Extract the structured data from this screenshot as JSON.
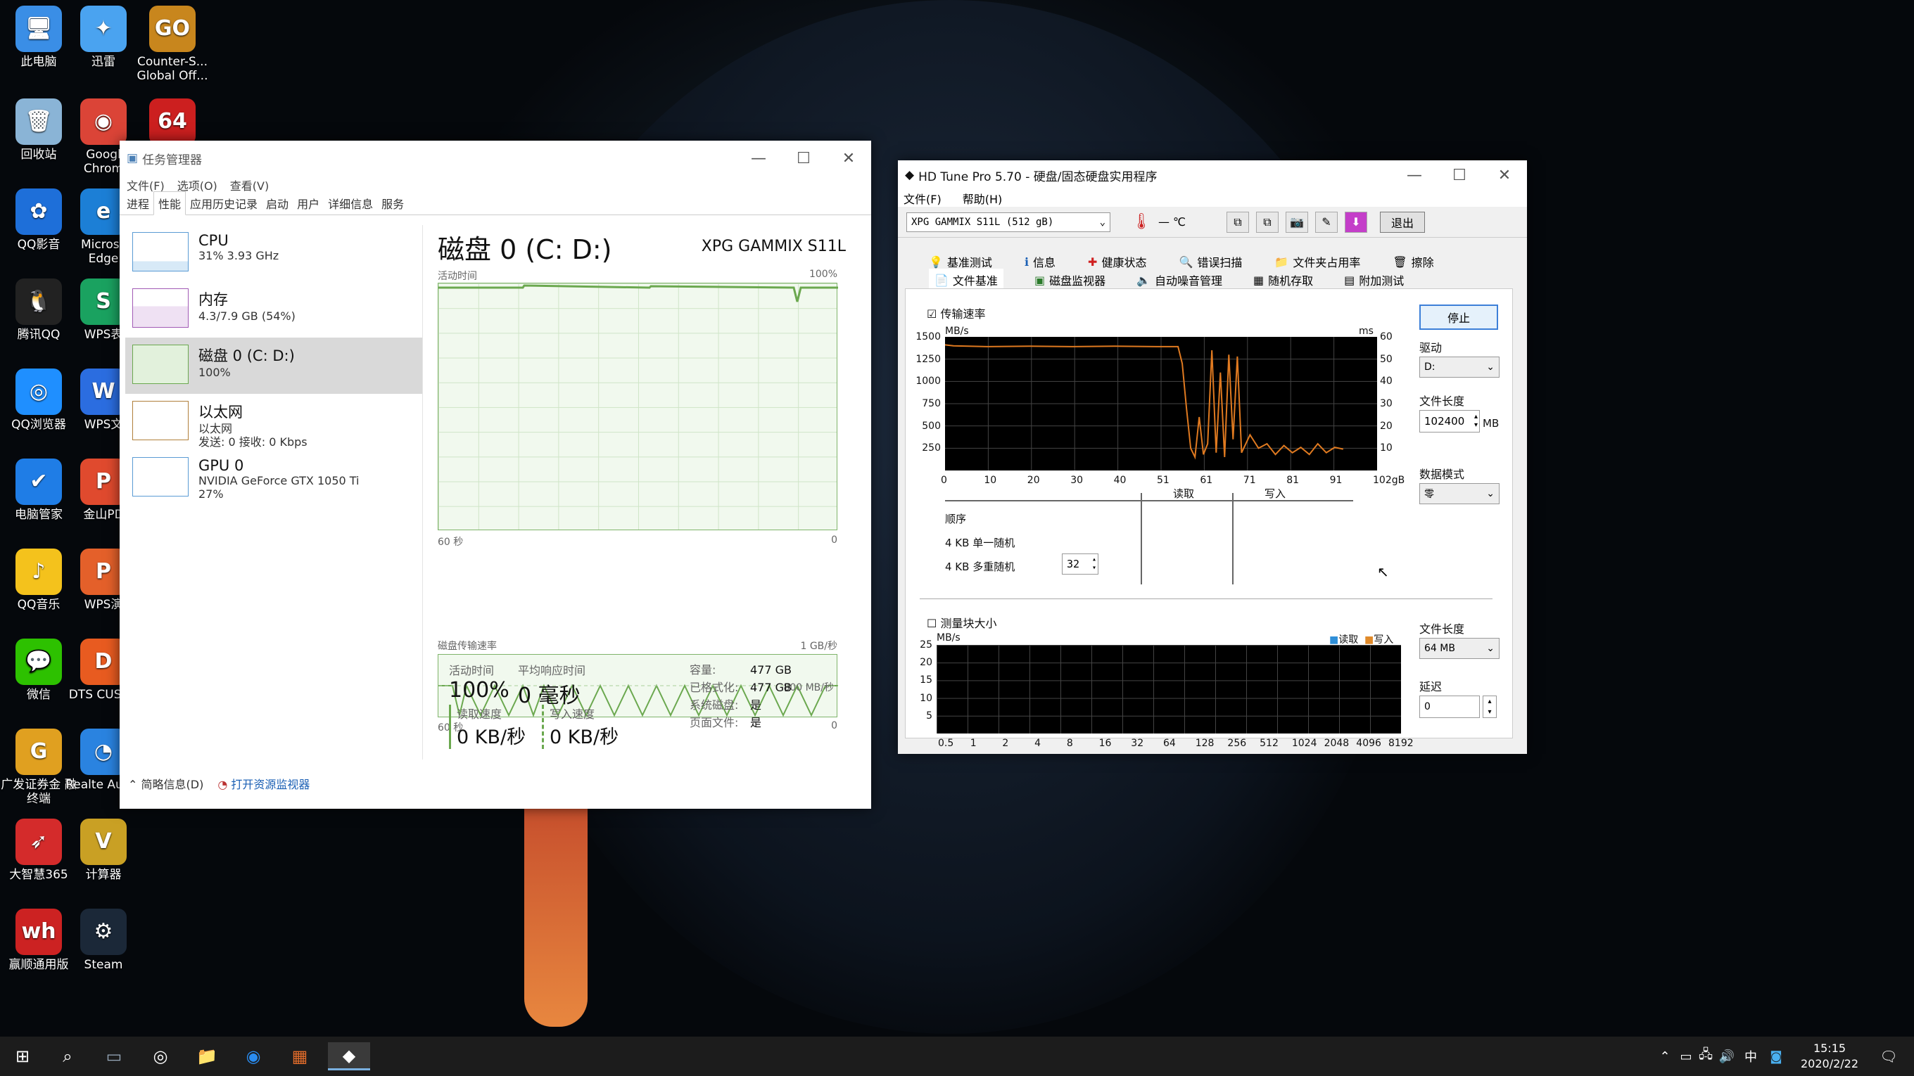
{
  "desktop_icons": [
    {
      "label": "此电脑",
      "color": "#3a8ee6",
      "glyph": "🖥",
      "x": 0,
      "y": 8
    },
    {
      "label": "迅雷",
      "color": "#4aa3f0",
      "glyph": "✦",
      "x": 92,
      "y": 8
    },
    {
      "label": "Counter-S... Global Off...",
      "color": "#c8861d",
      "glyph": "GO",
      "x": 190,
      "y": 8
    },
    {
      "label": "回收站",
      "color": "#8ab4d6",
      "glyph": "🗑",
      "x": 0,
      "y": 140
    },
    {
      "label": "Googl Chrom",
      "color": "#db4437",
      "glyph": "◉",
      "x": 92,
      "y": 140
    },
    {
      "label": "",
      "color": "#cc1f1f",
      "glyph": "64",
      "x": 190,
      "y": 140
    },
    {
      "label": "QQ影音",
      "color": "#1e6fd9",
      "glyph": "✿",
      "x": 0,
      "y": 268
    },
    {
      "label": "Microsc Edge",
      "color": "#1c7fd6",
      "glyph": "e",
      "x": 92,
      "y": 268
    },
    {
      "label": "腾讯QQ",
      "color": "#222",
      "glyph": "🐧",
      "x": 0,
      "y": 396
    },
    {
      "label": "WPS表",
      "color": "#1aa260",
      "glyph": "S",
      "x": 92,
      "y": 396
    },
    {
      "label": "QQ浏览器",
      "color": "#1f8fff",
      "glyph": "◎",
      "x": 0,
      "y": 524
    },
    {
      "label": "WPS文",
      "color": "#2b6de0",
      "glyph": "W",
      "x": 92,
      "y": 524
    },
    {
      "label": "电脑管家",
      "color": "#1f7de6",
      "glyph": "✔",
      "x": 0,
      "y": 652
    },
    {
      "label": "金山PD",
      "color": "#e04a2e",
      "glyph": "P",
      "x": 92,
      "y": 652
    },
    {
      "label": "QQ音乐",
      "color": "#f4c21c",
      "glyph": "♪",
      "x": 0,
      "y": 780
    },
    {
      "label": "WPS演",
      "color": "#e4602a",
      "glyph": "P",
      "x": 92,
      "y": 780
    },
    {
      "label": "微信",
      "color": "#2dc100",
      "glyph": "💬",
      "x": 0,
      "y": 908
    },
    {
      "label": "DTS CUSTO",
      "color": "#e85b20",
      "glyph": "D",
      "x": 92,
      "y": 908
    },
    {
      "label": "广发证券金 融终端",
      "color": "#e0a020",
      "glyph": "G",
      "x": 0,
      "y": 1036
    },
    {
      "label": "Realte Audio",
      "color": "#2a83e0",
      "glyph": "◔",
      "x": 92,
      "y": 1036
    },
    {
      "label": "大智慧365",
      "color": "#d42b2b",
      "glyph": "➶",
      "x": 0,
      "y": 1164
    },
    {
      "label": "计算器",
      "color": "#c9a024",
      "glyph": "V",
      "x": 92,
      "y": 1164
    },
    {
      "label": "赢顺通用版",
      "color": "#c22",
      "glyph": "wh",
      "x": 0,
      "y": 1292
    },
    {
      "label": "Steam",
      "color": "#1b2838",
      "glyph": "⚙",
      "x": 92,
      "y": 1292
    }
  ],
  "taskmgr": {
    "title": "任务管理器",
    "menu": [
      "文件(F)",
      "选项(O)",
      "查看(V)"
    ],
    "tabs": [
      "进程",
      "性能",
      "应用历史记录",
      "启动",
      "用户",
      "详细信息",
      "服务"
    ],
    "items": [
      {
        "name": "CPU",
        "l1": "31% 3.93 GHz",
        "l2": ""
      },
      {
        "name": "内存",
        "l1": "4.3/7.9 GB (54%)",
        "l2": ""
      },
      {
        "name": "磁盘 0 (C: D:)",
        "l1": "100%",
        "l2": ""
      },
      {
        "name": "以太网",
        "l1": "以太网",
        "l2": "发送: 0 接收: 0 Kbps"
      },
      {
        "name": "GPU 0",
        "l1": "NVIDIA GeForce GTX 1050 Ti",
        "l2": "27%"
      }
    ],
    "disk_title": "磁盘 0 (C: D:)",
    "model": "XPG GAMMIX S11L",
    "g1_label": "活动时间",
    "g1_max": "100%",
    "g1_time": "60 秒",
    "g1_min": "0",
    "g2_label": "磁盘传输速率",
    "g2_max": "1 GB/秒",
    "g2_mid": "800 MB/秒",
    "g2_time": "60 秒",
    "g2_min": "0",
    "active_label": "活动时间",
    "active_value": "100%",
    "resp_label": "平均响应时间",
    "resp_value": "0 毫秒",
    "read_label": "读取速度",
    "read_value": "0 KB/秒",
    "write_label": "写入速度",
    "write_value": "0 KB/秒",
    "cap_label": "容量:",
    "cap_value": "477 GB",
    "fmt_label": "已格式化:",
    "fmt_value": "477 GB",
    "sys_label": "系统磁盘:",
    "sys_value": "是",
    "page_label": "页面文件:",
    "page_value": "是",
    "brief": "简略信息(D)",
    "resmon": "打开资源监视器"
  },
  "hdtune": {
    "title": "HD Tune Pro 5.70 - 硬盘/固态硬盘实用程序",
    "menu": [
      "文件(F)",
      "帮助(H)"
    ],
    "drive_combo": "XPG GAMMIX S11L (512 gB)",
    "temp": "— ℃",
    "exit": "退出",
    "tabs_row1": [
      "基准测试",
      "信息",
      "健康状态",
      "错误扫描",
      "文件夹占用率",
      "擦除"
    ],
    "tabs_row2": [
      "文件基准",
      "磁盘监视器",
      "自动噪音管理",
      "随机存取",
      "附加测试"
    ],
    "chk_transfer": "传输速率",
    "y_unit": "MB/s",
    "y2_unit": "ms",
    "y_ticks": [
      "1500",
      "1250",
      "1000",
      "750",
      "500",
      "250"
    ],
    "y2_ticks": [
      "60",
      "50",
      "40",
      "30",
      "20",
      "10"
    ],
    "x_ticks": [
      "0",
      "10",
      "20",
      "30",
      "40",
      "51",
      "61",
      "71",
      "81",
      "91",
      "102gB"
    ],
    "col_read": "读取",
    "col_write": "写入",
    "row_seq": "顺序",
    "row_4k": "4 KB 单一随机",
    "row_4kq": "4 KB 多重随机",
    "queue": "32",
    "btn_stop": "停止",
    "lbl_drive": "驱动",
    "drive_value": "D:",
    "lbl_filelen": "文件长度",
    "filelen_value": "102400",
    "filelen_unit": "MB",
    "lbl_datamode": "数据模式",
    "datamode_value": "零",
    "chk_block": "测量块大小",
    "b_unit": "MB/s",
    "legend_read": "读取",
    "legend_write": "写入",
    "b_y_ticks": [
      "25",
      "20",
      "15",
      "10",
      "5"
    ],
    "b_x_ticks": [
      "0.5",
      "1",
      "2",
      "4",
      "8",
      "16",
      "32",
      "64",
      "128",
      "256",
      "512",
      "1024",
      "2048",
      "4096",
      "8192"
    ],
    "lbl_filelen2": "文件长度",
    "filelen2_value": "64 MB",
    "lbl_delay": "延迟",
    "delay_value": "0"
  },
  "taskbar": {
    "time": "15:15",
    "date": "2020/2/22",
    "ime": "中"
  },
  "chart_data": {
    "type": "line",
    "title": "",
    "xlabel": "",
    "ylabel": "MB/s",
    "x_unit": "gB",
    "xlim": [
      0,
      102
    ],
    "ylim": [
      0,
      1500
    ],
    "series": [
      {
        "name": "",
        "values_x": [
          0,
          2,
          10,
          20,
          30,
          40,
          50,
          55,
          56,
          57,
          58,
          59,
          60,
          61,
          62,
          63,
          64,
          65,
          66,
          67,
          68,
          69,
          70,
          72,
          74,
          76,
          78,
          80,
          82,
          84,
          86,
          88,
          90,
          92,
          94
        ],
        "values_y": [
          1410,
          1400,
          1390,
          1395,
          1390,
          1395,
          1390,
          1390,
          1200,
          700,
          250,
          150,
          600,
          180,
          300,
          1350,
          200,
          1100,
          150,
          1300,
          350,
          1280,
          200,
          400,
          250,
          300,
          180,
          280,
          200,
          260,
          180,
          300,
          200,
          260,
          240
        ]
      }
    ]
  }
}
